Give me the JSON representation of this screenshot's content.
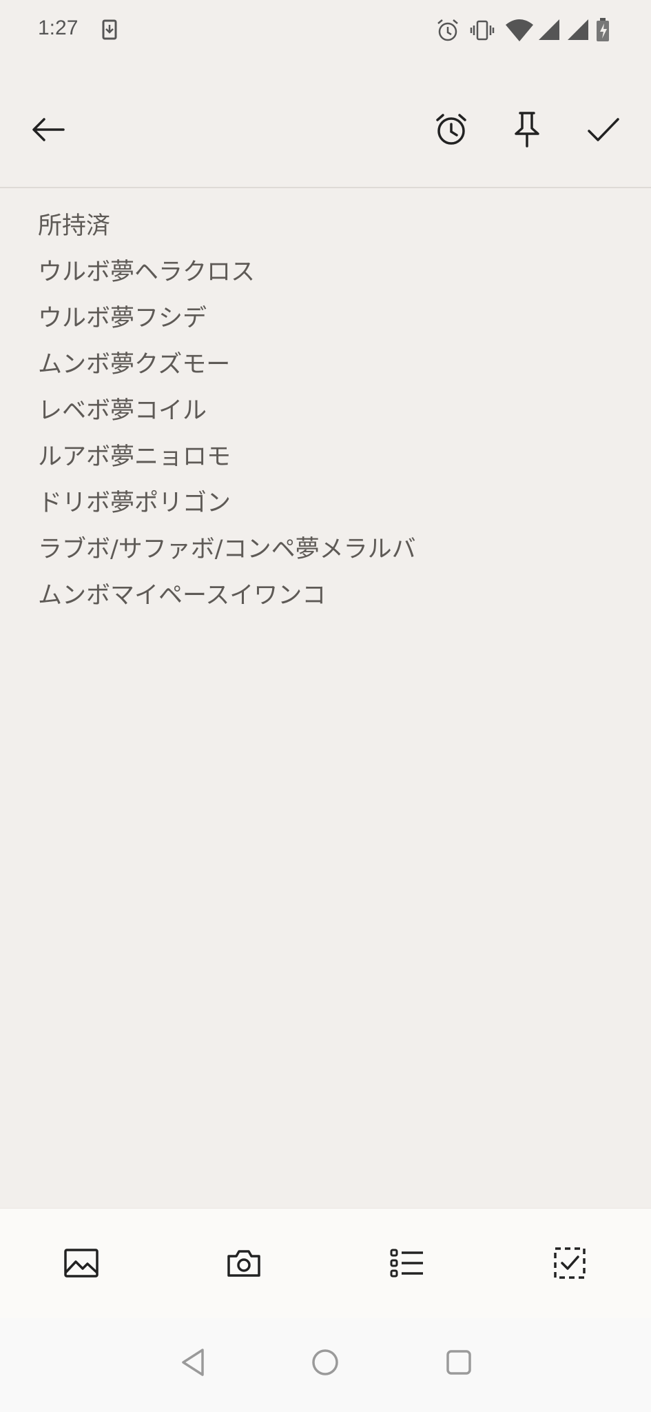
{
  "status_bar": {
    "time": "1:27",
    "icons": [
      "download-icon",
      "alarm-icon",
      "vibrate-icon",
      "wifi-icon",
      "signal-icon",
      "signal-icon-2",
      "battery-charging-icon"
    ]
  },
  "toolbar": {
    "back_icon": "arrow-left-icon",
    "actions": [
      "alarm-clock-icon",
      "pin-icon",
      "check-icon"
    ]
  },
  "note": {
    "lines": [
      "所持済",
      "ウルボ夢ヘラクロス",
      "ウルボ夢フシデ",
      "ムンボ夢クズモー",
      "レベボ夢コイル",
      "ルアボ夢ニョロモ",
      "ドリボ夢ポリゴン",
      "ラブボ/サファボ/コンペ夢メラルバ",
      "ムンボマイペースイワンコ"
    ]
  },
  "action_bar": {
    "items": [
      "image-icon",
      "camera-icon",
      "bulleted-list-icon",
      "checkbox-list-icon"
    ]
  },
  "nav_bar": {
    "items": [
      "back-triangle-icon",
      "home-circle-icon",
      "recents-square-icon"
    ]
  },
  "colors": {
    "paper": "#f2efec",
    "text": "#5e5a56",
    "icon": "#2b2b2b"
  }
}
